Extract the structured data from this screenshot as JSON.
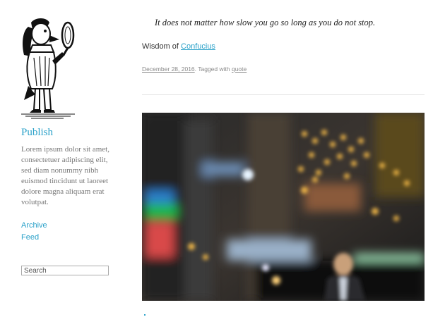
{
  "sidebar": {
    "logo_icon": "victorian-gentleman-illustration",
    "title": "Publish",
    "description": "Lorem ipsum dolor sit amet, consectetuer adipiscing elit, sed diam nonummy nibh euismod tincidunt ut laoreet dolore magna aliquam erat volutpat.",
    "nav": [
      "Archive",
      "Feed"
    ],
    "search_placeholder": "Search"
  },
  "post": {
    "quote": "It does not matter how slow you go so long as you do not stop.",
    "attribution_prefix": "Wisdom of ",
    "attribution_link": "Confucius",
    "date": "December 28, 2016",
    "tagged_text": ". Tagged with ",
    "tag": "quote"
  },
  "colors": {
    "link": "#2aa1c9",
    "divider": "#e5e5e5"
  }
}
